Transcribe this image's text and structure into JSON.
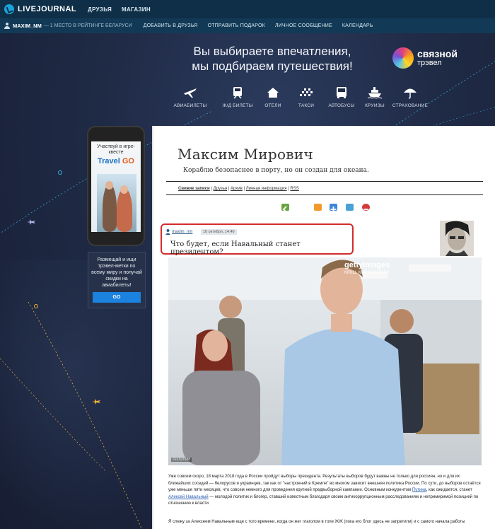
{
  "topbar": {
    "logo": "LIVEJOURNAL",
    "nav": [
      "ДРУЗЬЯ",
      "МАГАЗИН"
    ]
  },
  "subbar": {
    "user": "MAXIM_NM",
    "rank": "— 1 МЕСТО В РЕЙТИНГЕ БЕЛАРУСИ",
    "links": [
      "ДОБАВИТЬ В ДРУЗЬЯ",
      "ОТПРАВИТЬ ПОДАРОК",
      "ЛИЧНОЕ СООБЩЕНИЕ",
      "КАЛЕНДАРЬ"
    ]
  },
  "promo": {
    "line1": "Вы выбираете впечатления,",
    "line2": "мы подбираем путешествия!",
    "brand_1": "связной",
    "brand_2": "трэвел",
    "items": [
      "АВИАБИЛЕТЫ",
      "Ж/Д БИЛЕТЫ",
      "ОТЕЛИ",
      "ТАКСИ",
      "АВТОБУСЫ",
      "КРУИЗЫ",
      "СТРАХОВАНИЕ"
    ]
  },
  "ad": {
    "phone_text": "Участвуй в игре-квесте",
    "phone_brand_1": "Travel",
    "phone_brand_2": "GO",
    "box_text": "Размещай и ищи трэвел-метки по всему миру и получай скидки на авиабилеты!",
    "button": "GO"
  },
  "journal": {
    "title": "Максим Мирович",
    "subtitle": "Кораблю безопаснее в порту, но он создан для океана.",
    "nav": [
      "Свежие записи",
      "Друзья",
      "Архив",
      "Личная информация",
      "RSS"
    ]
  },
  "post": {
    "user": "maxim_nm",
    "date": "10 октября, 14:40",
    "title": "Что будет, если Навальный станет президентом?",
    "photo_watermark": "gettyimages",
    "photo_credit": "KIRILL KUDRYAVTSEV",
    "photo_id": "615197988",
    "p1a": "Уже совсем скоро, 18 марта 2018 года в России пройдут выборы президента. Результаты выборов будут важны не только для россиян, но и для их ближайших соседей — белорусов и украинцев, так как от \"настроений в Кремле\" во многом зависит внешняя политика России. По сути, до выборов остаётся уже меньше пяти месяцев, что совсем немного для проведения крупной предвыборной кампании. Основным конкурентом",
    "p1_link1": "Путина",
    "p1b": ", как ожидается, станет",
    "p1_link2": "Алексей Навальный",
    "p1c": "— молодой политик и блогер, ставший известным благодаря своим антикоррупционным расследованиям и непримиримой позицией по отношению к власти.",
    "p2": "Я слежу за Алексеем Навальным еще с того времени, когда он жег глаголом в топе ЖЖ (пока его блог здесь не запретили) и с самого начала работы"
  },
  "colors": {
    "topbar": "#0f2f48",
    "subbar": "#123a56",
    "highlight": "#d42c2c",
    "link": "#2a5db0"
  }
}
